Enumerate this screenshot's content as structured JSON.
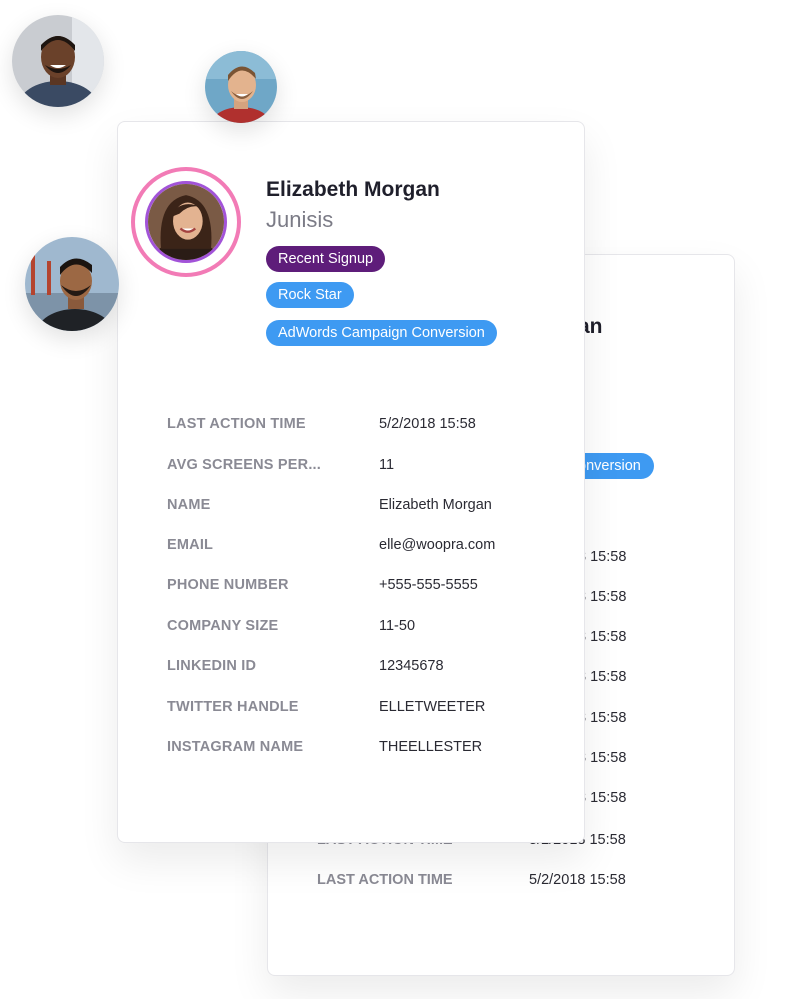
{
  "profile": {
    "name": "Elizabeth Morgan",
    "company": "Junisis",
    "tags": [
      {
        "label": "Recent Signup",
        "color": "#5e1d7a"
      },
      {
        "label": "Rock Star",
        "color": "#3e9af2"
      },
      {
        "label": "AdWords Campaign Conversion",
        "color": "#3e9af2"
      }
    ],
    "ring_color": "#f27bb6"
  },
  "details": [
    {
      "label": "LAST ACTION TIME",
      "value": "5/2/2018 15:58"
    },
    {
      "label": "AVG SCREENS PER...",
      "value": "11"
    },
    {
      "label": "NAME",
      "value": "Elizabeth Morgan"
    },
    {
      "label": "EMAIL",
      "value": "elle@woopra.com"
    },
    {
      "label": "PHONE NUMBER",
      "value": "+555-555-5555"
    },
    {
      "label": "COMPANY SIZE",
      "value": "11-50"
    },
    {
      "label": "LINKEDIN ID",
      "value": "12345678"
    },
    {
      "label": "TWITTER HANDLE",
      "value": "ELLETWEETER"
    },
    {
      "label": "INSTAGRAM NAME",
      "value": "THEELLESTER"
    }
  ],
  "back_card": {
    "name_fragment": "an",
    "tag_fragment": "onversion",
    "time_fragments": [
      "8 15:58",
      "8 15:58",
      "8 15:58",
      "8 15:58",
      "8 15:58",
      "8 15:58",
      "8 15:58"
    ],
    "partial_row": {
      "label": "LAST ACTION TIME",
      "value": "5/2/2018 15:58"
    },
    "last_row": {
      "label": "LAST ACTION TIME",
      "value": "5/2/2018 15:58"
    }
  },
  "avatars": [
    "avatar-man-beard",
    "avatar-man-smiling",
    "avatar-man-bridge"
  ]
}
